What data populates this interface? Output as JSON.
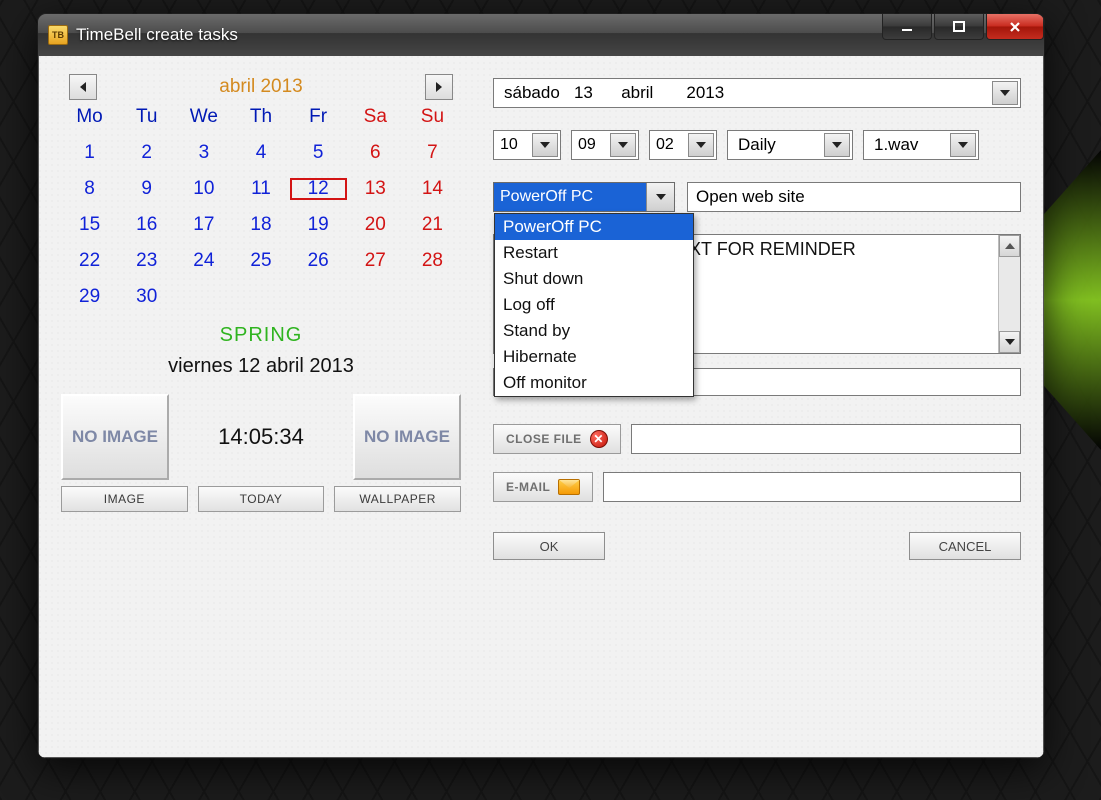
{
  "window": {
    "title": "TimeBell create tasks",
    "icon_label": "TB"
  },
  "calendar": {
    "month_title": "abril 2013",
    "day_headers": [
      "Mo",
      "Tu",
      "We",
      "Th",
      "Fr",
      "Sa",
      "Su"
    ],
    "weeks": [
      [
        "1",
        "2",
        "3",
        "4",
        "5",
        "6",
        "7"
      ],
      [
        "8",
        "9",
        "10",
        "11",
        "12",
        "13",
        "14"
      ],
      [
        "15",
        "16",
        "17",
        "18",
        "19",
        "20",
        "21"
      ],
      [
        "22",
        "23",
        "24",
        "25",
        "26",
        "27",
        "28"
      ],
      [
        "29",
        "30",
        "",
        "",
        "",
        "",
        ""
      ]
    ],
    "today_index": [
      1,
      4
    ],
    "season": "SPRING",
    "long_date": "viernes 12 abril 2013",
    "clock": "14:05:34",
    "noimage_label": "NO IMAGE",
    "buttons": {
      "image": "IMAGE",
      "today": "TODAY",
      "wallpaper": "WALLPAPER"
    }
  },
  "task": {
    "date_display": "sábado   13      abril       2013",
    "time": {
      "hour": "10",
      "minute": "09",
      "second": "02"
    },
    "repeat": "Daily",
    "sound": "1.wav",
    "action_selected": "PowerOff PC",
    "action_display_truncated": "PowerOff PC",
    "action_options": [
      "PowerOff PC",
      "Restart",
      "Shut down",
      "Log off",
      "Stand by",
      "Hibernate",
      "Off monitor"
    ],
    "website_label": "Open web site",
    "reminder_text": "EXT FOR REMINDER",
    "close_file_label": "CLOSE FILE",
    "email_label": "E-MAIL",
    "ok": "OK",
    "cancel": "CANCEL"
  }
}
